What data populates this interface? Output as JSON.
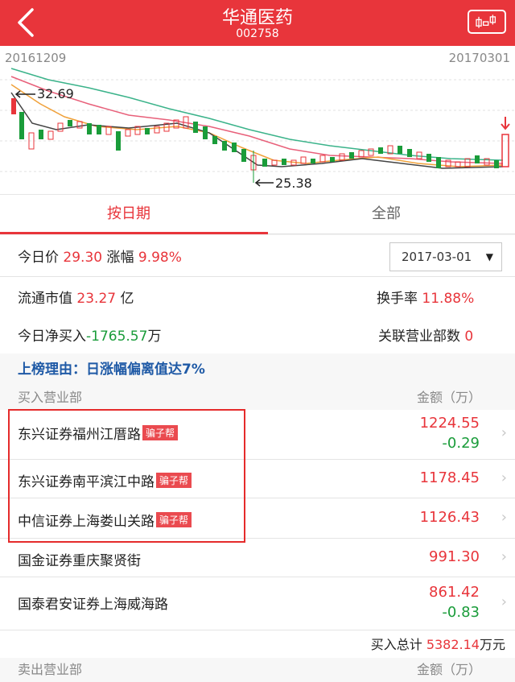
{
  "header": {
    "title": "华通医药",
    "code": "002758"
  },
  "chart": {
    "start_date": "20161209",
    "end_date": "20170301",
    "high_label": "32.69",
    "low_label": "25.38"
  },
  "tabs": [
    {
      "label": "按日期",
      "active": true
    },
    {
      "label": "全部",
      "active": false
    }
  ],
  "summary": {
    "price_label": "今日价",
    "price": "29.30",
    "change_label": "涨幅",
    "change": "9.98%",
    "date": "2017-03-01",
    "mcap_label": "流通市值",
    "mcap_value": "23.27",
    "mcap_unit": "亿",
    "turnover_label": "换手率",
    "turnover": "11.88%",
    "netbuy_label": "今日净买入",
    "netbuy_value": "-1765.57",
    "netbuy_unit": "万",
    "branches_label": "关联营业部数",
    "branches": "0"
  },
  "reason": "上榜理由：日涨幅偏离值达7%",
  "buy_section": {
    "title": "买入营业部",
    "amount_label": "金额（万）"
  },
  "buy_rows": [
    {
      "name": "东兴证券福州江厝路",
      "badge": "骗子帮",
      "v1": "1224.55",
      "v2": "-0.29"
    },
    {
      "name": "东兴证券南平滨江中路",
      "badge": "骗子帮",
      "v1": "1178.45",
      "v2": ""
    },
    {
      "name": "中信证券上海娄山关路",
      "badge": "骗子帮",
      "v1": "1126.43",
      "v2": ""
    },
    {
      "name": "国金证券重庆聚贤街",
      "badge": "",
      "v1": "991.30",
      "v2": ""
    },
    {
      "name": "国泰君安证券上海威海路",
      "badge": "",
      "v1": "861.42",
      "v2": "-0.83"
    }
  ],
  "buy_total": {
    "label": "买入总计",
    "value": "5382.14",
    "unit": "万元"
  },
  "sell_section": {
    "title": "卖出营业部",
    "amount_label": "金额（万）"
  },
  "colors": {
    "brand": "#e8353b",
    "link": "#1f5aa6",
    "up": "#e8353b",
    "down": "#1a9c3a"
  },
  "icons": {
    "back": "chevron-left-icon",
    "switch": "kline-toggle-icon",
    "row": "chevron-right-icon"
  }
}
